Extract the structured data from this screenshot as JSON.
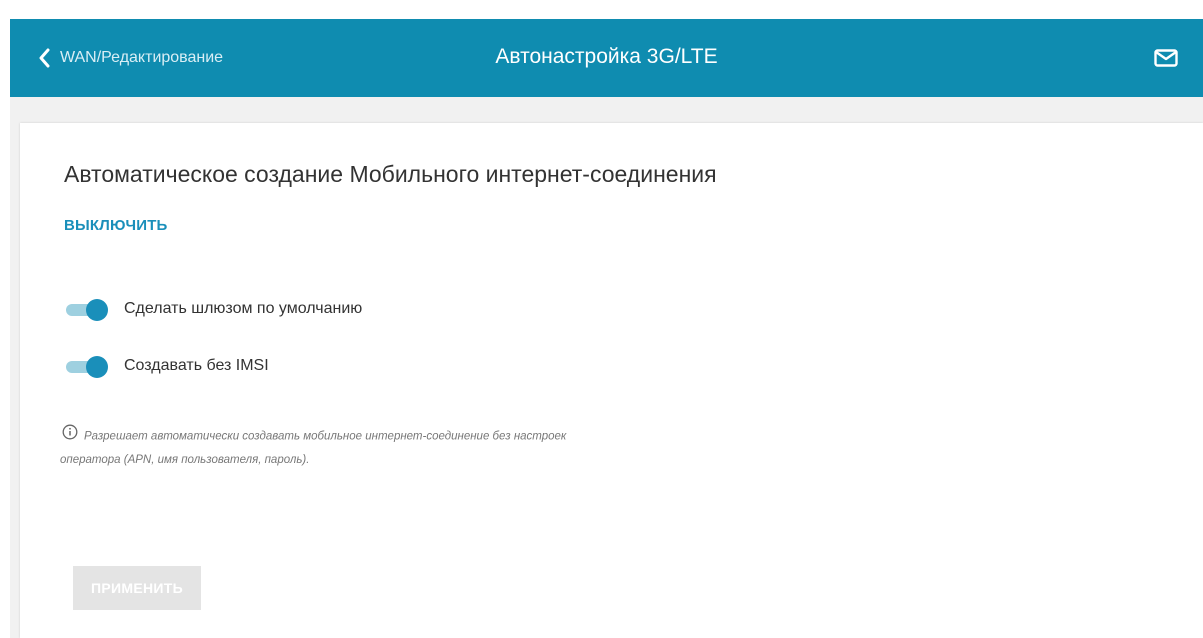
{
  "header": {
    "back_label": "WAN/Редактирование",
    "title": "Автонастройка 3G/LTE",
    "background_color": "#0f8cb0",
    "back_icon": "chevron-left-icon",
    "mail_icon": "mail-icon"
  },
  "card": {
    "title": "Автоматическое создание Мобильного интернет-соединения",
    "disable_link": "ВЫКЛЮЧИТЬ",
    "toggles": [
      {
        "label": "Сделать шлюзом по умолчанию",
        "enabled": true
      },
      {
        "label": "Создавать без IMSI",
        "enabled": true
      }
    ],
    "hint_icon": "info-icon",
    "hint_text": "Разрешает автоматически создавать мобильное интернет-соединение без настроек оператора (APN, имя пользователя, пароль).",
    "apply_label": "ПРИМЕНИТЬ",
    "apply_enabled": false,
    "accent_color": "#1a8fba"
  }
}
